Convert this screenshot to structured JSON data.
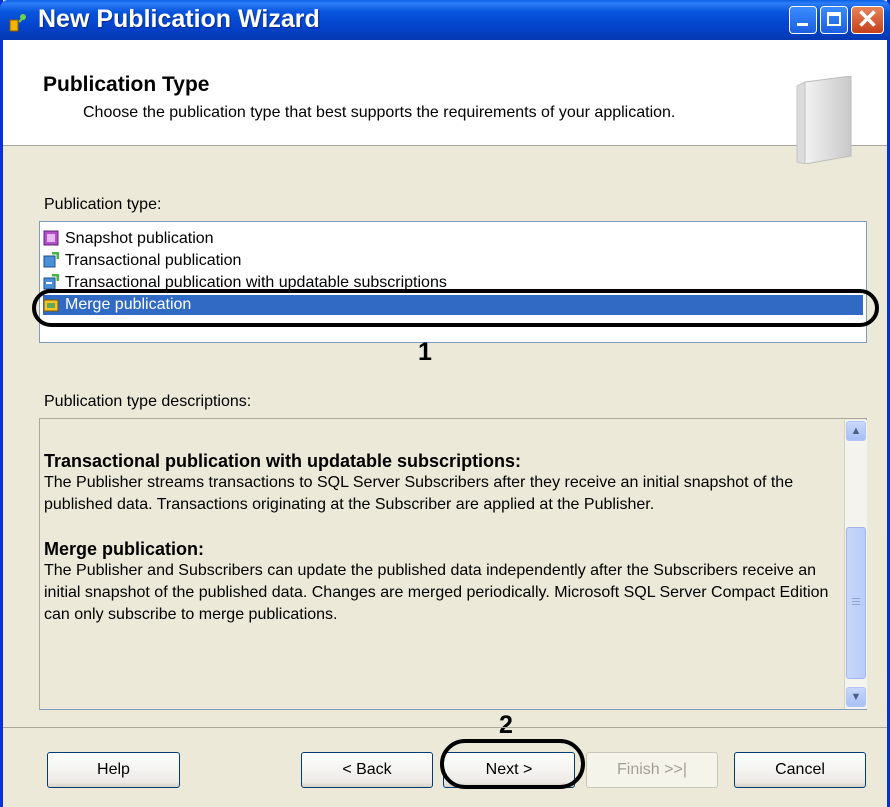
{
  "window": {
    "title": "New Publication Wizard",
    "accent": "#0831d9"
  },
  "header": {
    "title": "Publication Type",
    "subtitle": "Choose the publication type that best supports the requirements of your application."
  },
  "publication_types": {
    "label": "Publication type:",
    "items": [
      {
        "label": "Snapshot publication",
        "icon": "snapshot-publication-icon",
        "selected": false
      },
      {
        "label": "Transactional publication",
        "icon": "transactional-publication-icon",
        "selected": false
      },
      {
        "label": "Transactional publication with updatable subscriptions",
        "icon": "updatable-publication-icon",
        "selected": false
      },
      {
        "label": "Merge publication",
        "icon": "merge-publication-icon",
        "selected": true
      }
    ],
    "callout_number": "1"
  },
  "descriptions": {
    "label": "Publication type descriptions:",
    "sections": [
      {
        "heading": "Transactional publication with updatable subscriptions:",
        "body": "The Publisher streams transactions to SQL Server Subscribers after they receive an initial snapshot of the published data. Transactions originating at the Subscriber are applied at the Publisher."
      },
      {
        "heading": "Merge publication:",
        "body": "The Publisher and Subscribers can update the published data independently after the Subscribers receive an initial snapshot of the published data. Changes are merged periodically. Microsoft SQL Server Compact Edition can only subscribe to merge publications."
      }
    ]
  },
  "buttons": {
    "help": "Help",
    "back": "< Back",
    "next": "Next >",
    "finish": "Finish >>|",
    "cancel": "Cancel",
    "callout_number": "2"
  }
}
